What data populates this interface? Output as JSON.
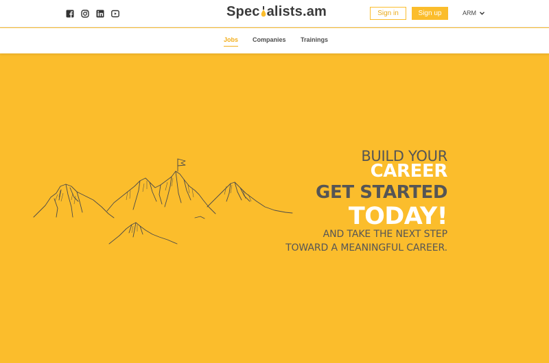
{
  "header": {
    "logo": {
      "before": "Spec",
      "after": "alists.am"
    },
    "socials": [
      "facebook-icon",
      "instagram-icon",
      "linkedin-icon",
      "youtube-icon"
    ],
    "signin_label": "Sign in",
    "signup_label": "Sign up",
    "language": "ARM"
  },
  "nav": {
    "items": [
      {
        "label": "Jobs",
        "active": true
      },
      {
        "label": "Companies",
        "active": false
      },
      {
        "label": "Trainings",
        "active": false
      }
    ]
  },
  "hero": {
    "line1": "BUILD YOUR",
    "line2": "CAREER",
    "line3": "GET STARTED",
    "line4": "TODAY!",
    "line5": "AND TAKE THE NEXT STEP",
    "line6": "TOWARD A MEANINGFUL CAREER."
  },
  "colors": {
    "brand": "#fbbd2c",
    "text_dark": "#555555",
    "white": "#ffffff"
  }
}
